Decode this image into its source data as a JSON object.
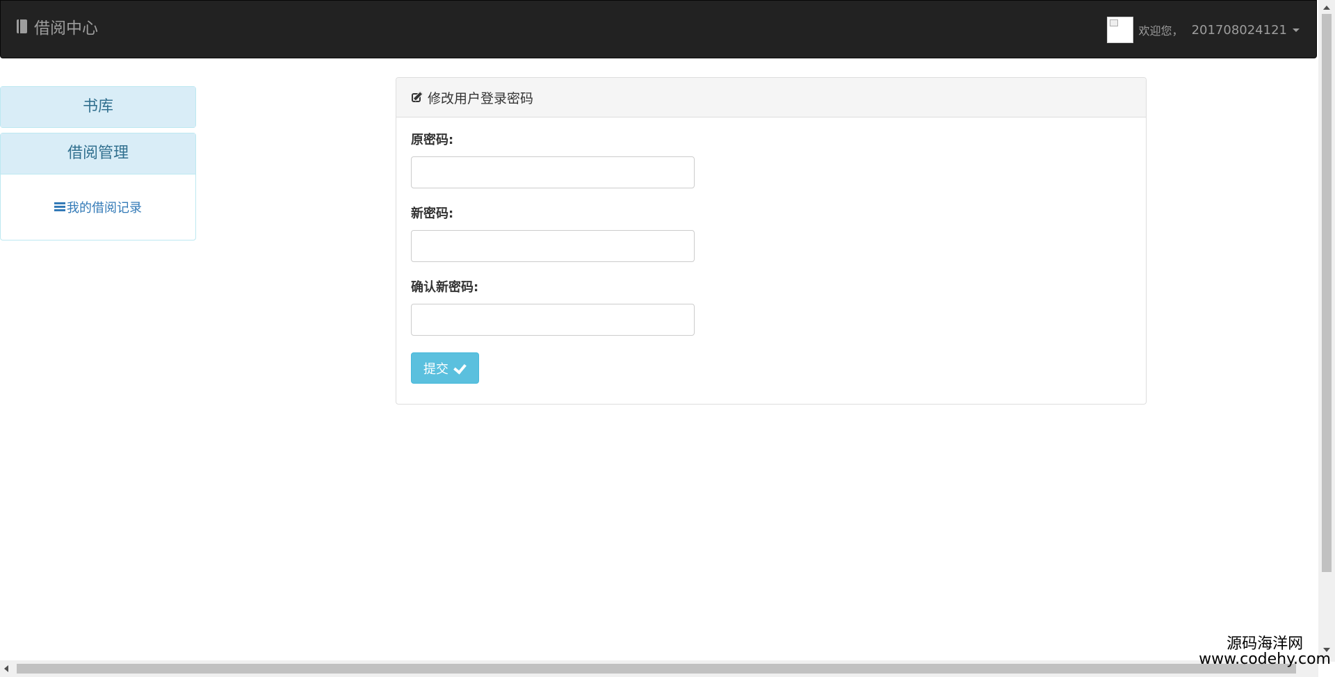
{
  "navbar": {
    "brand": "借阅中心",
    "welcome": "欢迎您，",
    "username": "201708024121"
  },
  "sidebar": {
    "library": {
      "label": "书库"
    },
    "borrow": {
      "label": "借阅管理",
      "items": [
        {
          "label": "我的借阅记录",
          "icon": "list-icon"
        }
      ]
    }
  },
  "form": {
    "title": "修改用户登录密码",
    "old_password_label": "原密码:",
    "new_password_label": "新密码:",
    "confirm_password_label": "确认新密码:",
    "old_password_value": "",
    "new_password_value": "",
    "confirm_password_value": "",
    "submit_label": "提交"
  },
  "watermark": {
    "line1": "源码海洋网",
    "line2": "www.codehy.com"
  },
  "colors": {
    "navbar_bg": "#222222",
    "sidebar_head_bg": "#d9edf7",
    "sidebar_text": "#31708f",
    "link": "#337ab7",
    "submit_bg": "#5bc0de"
  }
}
